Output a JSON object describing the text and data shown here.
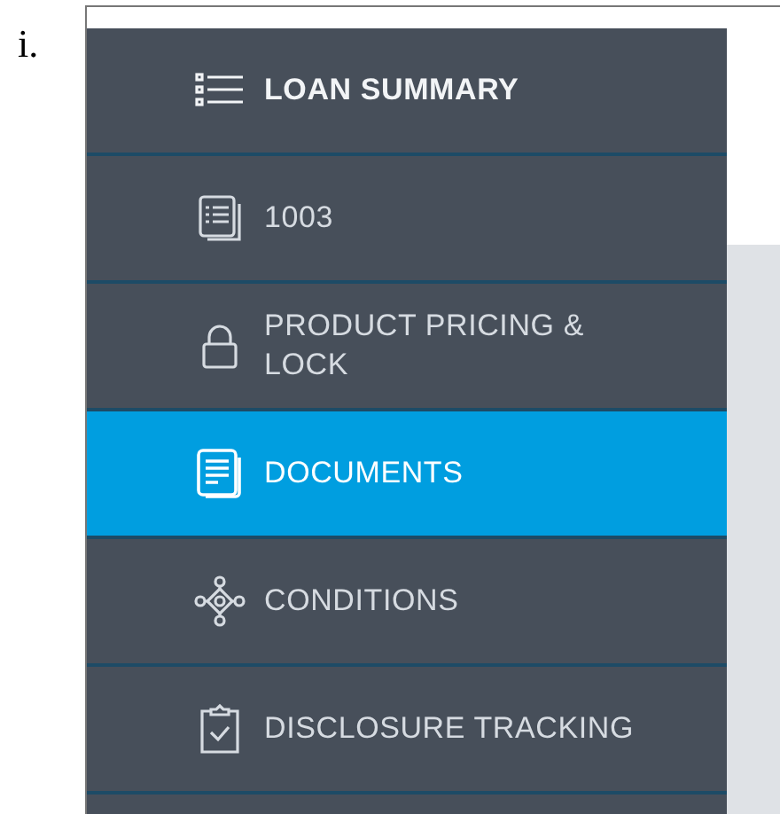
{
  "list_marker": "i.",
  "sidebar": {
    "items": [
      {
        "label": "LOAN SUMMARY",
        "kind": "heading",
        "selected": false
      },
      {
        "label": "1003",
        "kind": "link",
        "selected": false
      },
      {
        "label": "PRODUCT PRICING & LOCK",
        "kind": "link",
        "selected": false
      },
      {
        "label": "DOCUMENTS",
        "kind": "link",
        "selected": true
      },
      {
        "label": "CONDITIONS",
        "kind": "link",
        "selected": false
      },
      {
        "label": "DISCLOSURE TRACKING",
        "kind": "link",
        "selected": false
      }
    ]
  }
}
